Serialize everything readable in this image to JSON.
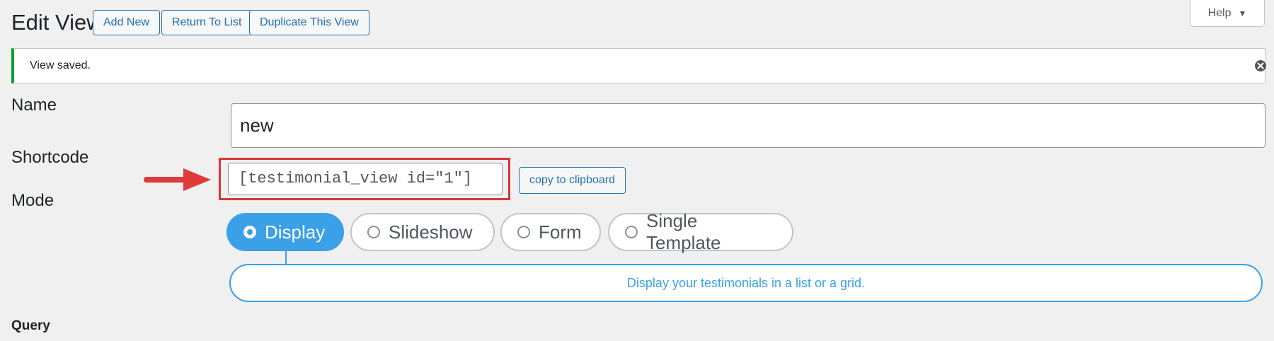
{
  "header": {
    "title": "Edit View",
    "buttons": [
      "Add New",
      "Return To List",
      "Duplicate This View"
    ],
    "help_label": "Help"
  },
  "notice": {
    "text": "View saved.",
    "color": "#00a32a",
    "dismiss_icon": "dismiss-circle-icon"
  },
  "form": {
    "name_label": "Name",
    "name_value": "new",
    "shortcode_label": "Shortcode",
    "shortcode_value": "[testimonial_view id=\"1\"]",
    "copy_label": "copy to clipboard",
    "mode_label": "Mode",
    "modes": [
      {
        "label": "Display",
        "selected": true
      },
      {
        "label": "Slideshow",
        "selected": false
      },
      {
        "label": "Form",
        "selected": false
      },
      {
        "label": "Single Template",
        "selected": false
      }
    ],
    "mode_description": "Display your testimonials in a list or a grid."
  },
  "section_heading": "Query",
  "colors": {
    "accent": "#3aa0e8",
    "link": "#2271b1",
    "highlight": "#d63638"
  }
}
